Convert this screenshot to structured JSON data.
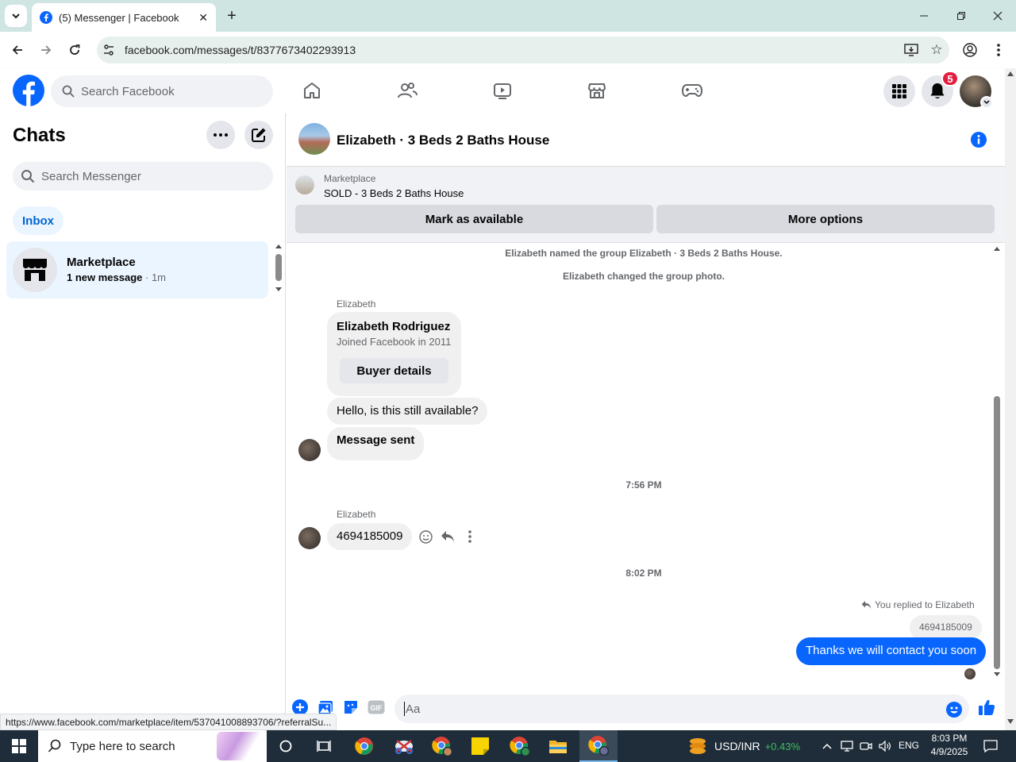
{
  "browser": {
    "tab_title": "(5) Messenger | Facebook",
    "url": "facebook.com/messages/t/8377673402293913",
    "status_url": "https://www.facebook.com/marketplace/item/537041008893706/?referralSu..."
  },
  "fb_nav": {
    "search_placeholder": "Search Facebook",
    "notification_count": "5"
  },
  "sidebar": {
    "title": "Chats",
    "search_placeholder": "Search Messenger",
    "filter_label": "Inbox",
    "chats": [
      {
        "name": "Marketplace",
        "preview": "1 new message",
        "time": "· 1m"
      }
    ]
  },
  "conversation": {
    "title": "Elizabeth · 3 Beds 2 Baths House",
    "marketplace_label": "Marketplace",
    "listing_status": "SOLD - 3 Beds 2 Baths House",
    "mark_available_label": "Mark as available",
    "more_options_label": "More options",
    "system_messages": [
      "Elizabeth named the group Elizabeth · 3 Beds 2 Baths House.",
      "Elizabeth changed the group photo."
    ],
    "sender_name": "Elizabeth",
    "card": {
      "name": "Elizabeth Rodriguez",
      "joined": "Joined Facebook in 2011",
      "button_label": "Buyer details"
    },
    "message_1": "Hello, is this still available?",
    "message_2": "Message sent",
    "time_1": "7:56 PM",
    "message_3": "4694185009",
    "time_2": "8:02 PM",
    "reply_context": "You replied to Elizabeth",
    "quoted_text": "4694185009",
    "my_message": "Thanks we will contact you soon",
    "composer_placeholder": "Aa"
  },
  "taskbar": {
    "search_placeholder": "Type here to search",
    "ticker_name": "USD/INR",
    "ticker_change": "+0.43%",
    "language": "ENG",
    "time": "8:03 PM",
    "date": "4/9/2025"
  },
  "colors": {
    "fb_blue": "#0866ff",
    "bubble_gray": "#f0f0f0",
    "badge_red": "#e41e3f",
    "ticker_green": "#3fbf5f"
  }
}
